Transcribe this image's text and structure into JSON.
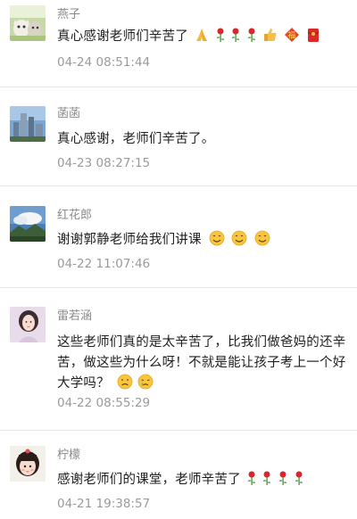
{
  "comments": [
    {
      "username": "燕子",
      "text": "真心感谢老师们辛苦了",
      "emoji": [
        "folded-hands",
        "rose",
        "rose",
        "rose",
        "thumbs-up",
        "red-envelope-blessing",
        "red-envelope"
      ],
      "timestamp": "04-24 08:51:44",
      "avatar": "cats-avatar"
    },
    {
      "username": "菡菡",
      "text": "真心感谢，老师们辛苦了。",
      "emoji": [],
      "timestamp": "04-23 08:27:15",
      "avatar": "city-buildings-avatar"
    },
    {
      "username": "红花郎",
      "text": "谢谢郭静老师给我们讲课",
      "emoji": [
        "smile",
        "smile",
        "smile"
      ],
      "timestamp": "04-22 11:07:46",
      "avatar": "mountain-sky-avatar"
    },
    {
      "username": "雷若涵",
      "text": "这些老师们真的是太辛苦了，比我们做爸妈的还辛苦，做这些为什么呀！不就是能让孩子考上一个好大学吗？",
      "emoji": [
        "sad-face",
        "crying-face"
      ],
      "timestamp": "04-22 08:55:29",
      "avatar": "girl-portrait-avatar"
    },
    {
      "username": "柠檬",
      "text": "感谢老师们的课堂，老师辛苦了",
      "emoji": [
        "rose",
        "rose",
        "rose",
        "rose"
      ],
      "timestamp": "04-21 19:38:57",
      "avatar": "girl-cartoon-avatar"
    }
  ],
  "colors": {
    "username": "#8a8a8a",
    "timestamp": "#9a9a9a",
    "divider": "#e6e6e6",
    "text": "#1f1f1f"
  }
}
